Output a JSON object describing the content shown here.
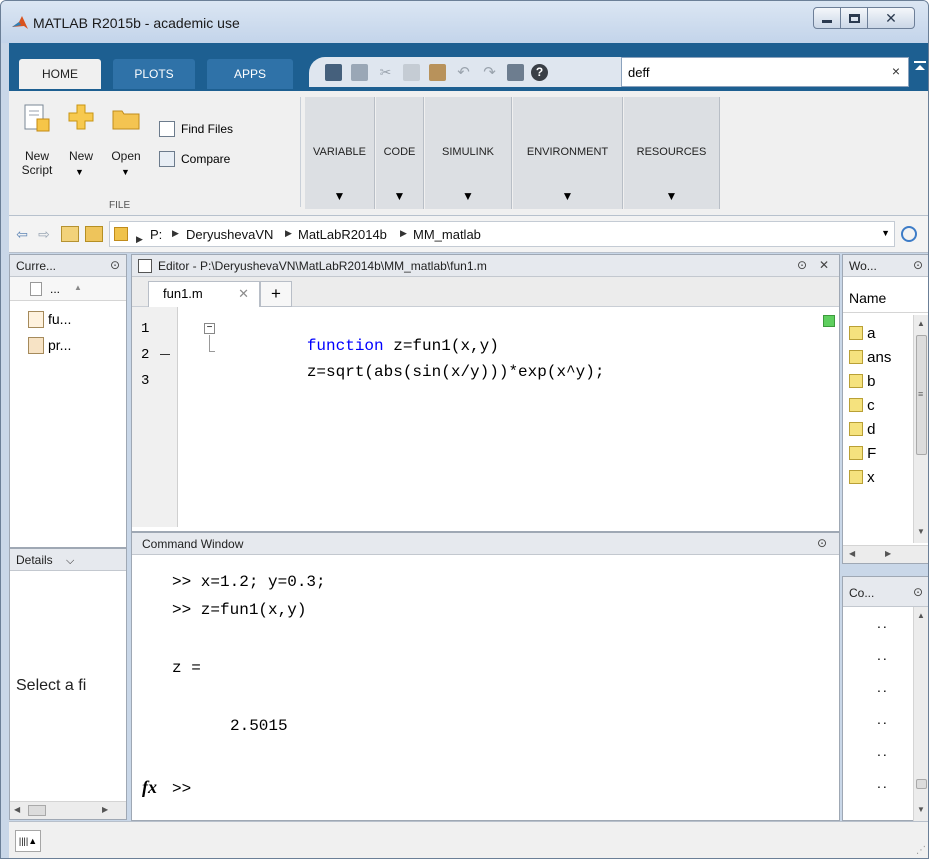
{
  "window": {
    "title": "MATLAB R2015b - academic use"
  },
  "tabs": [
    {
      "label": "HOME"
    },
    {
      "label": "PLOTS"
    },
    {
      "label": "APPS"
    }
  ],
  "search": {
    "value": "deff",
    "clear": "×"
  },
  "ribbon": {
    "new_script": [
      "New",
      "Script"
    ],
    "new": "New",
    "open": "Open",
    "find_files": "Find Files",
    "compare": "Compare",
    "file_section": "FILE",
    "groups": [
      "VARIABLE",
      "CODE",
      "SIMULINK",
      "ENVIRONMENT",
      "RESOURCES"
    ]
  },
  "address": {
    "crumbs": [
      "P:",
      "DeryushevaVN",
      "MatLabR2014b",
      "MM_matlab"
    ]
  },
  "current_folder": {
    "title": "Curre...",
    "col": "...",
    "files": [
      "fu...",
      "pr..."
    ],
    "details_title": "Details",
    "details_text": "Select a fi"
  },
  "editor": {
    "title": "Editor - P:\\DeryushevaVN\\MatLabR2014b\\MM_matlab\\fun1.m",
    "tab": "fun1.m",
    "lines": [
      {
        "num": "1",
        "keyword": "function",
        "rest": " z=fun1(x,y)"
      },
      {
        "num": "2",
        "keyword": "",
        "rest": "z=sqrt(abs(sin(x/y)))*exp(x^y);"
      },
      {
        "num": "3",
        "keyword": "",
        "rest": ""
      }
    ]
  },
  "command_window": {
    "title": "Command Window",
    "lines": [
      ">> x=1.2; y=0.3;",
      ">> z=fun1(x,y)",
      "z =",
      "2.5015"
    ],
    "prompt": ">>",
    "fx": "fx"
  },
  "workspace": {
    "title": "Wo...",
    "col_name": "Name",
    "vars": [
      "a",
      "ans",
      "b",
      "c",
      "d",
      "F",
      "x"
    ]
  },
  "command_history": {
    "title": "Co...",
    "items": [
      "..",
      "..",
      "..",
      "..",
      "..",
      ".."
    ]
  }
}
